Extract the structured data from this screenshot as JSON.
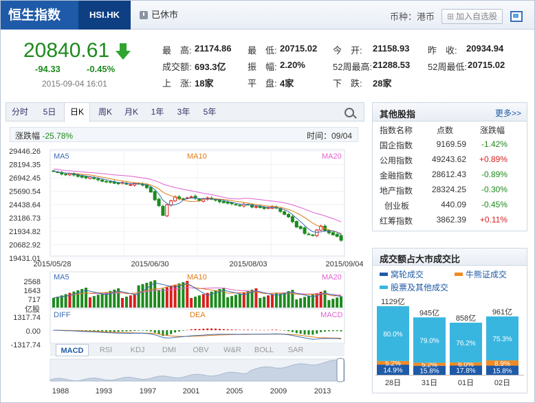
{
  "header": {
    "name": "恒生指数",
    "code": "HSI.HK",
    "status": "已休市",
    "currency": "币种：港币",
    "add_button": "加入自选股"
  },
  "quote": {
    "price": "20840.61",
    "change": "-94.33",
    "change_pct": "-0.45%",
    "time": "2015-09-04 16:01",
    "cells": [
      {
        "label": "最　高:",
        "value": "21174.86"
      },
      {
        "label": "最　低:",
        "value": "20715.02"
      },
      {
        "label": "今　开:",
        "value": "21158.93"
      },
      {
        "label": "昨　收:",
        "value": "20934.94"
      },
      {
        "label": "成交额:",
        "value": "693.3亿"
      },
      {
        "label": "振　幅:",
        "value": "2.20%"
      },
      {
        "label": "52周最高:",
        "value": "21288.53"
      },
      {
        "label": "52周最低:",
        "value": "20715.02"
      },
      {
        "label": "上　涨:",
        "value": "18家"
      },
      {
        "label": "平　盘:",
        "value": "4家"
      },
      {
        "label": "下　跌:",
        "value": "28家"
      }
    ]
  },
  "tabs": [
    "分时",
    "5日",
    "日K",
    "周K",
    "月K",
    "1年",
    "3年",
    "5年"
  ],
  "active_tab": "日K",
  "info": {
    "range_label": "涨跌幅",
    "range_value": "-25.78%",
    "time_label": "时间：",
    "time_value": "09/04"
  },
  "indicator_tabs": [
    "MACD",
    "RSI",
    "KDJ",
    "DMI",
    "OBV",
    "W&R",
    "BOLL",
    "SAR"
  ],
  "colors": {
    "up": "#d91e1e",
    "down": "#1d8a1d",
    "ma5": "#3a6db5",
    "ma10": "#e07b16",
    "ma20": "#e05fd0"
  },
  "chart_data": [
    {
      "type": "candlestick",
      "name": "kline",
      "labels": {
        "ma5": "MA5",
        "ma10": "MA10",
        "ma20": "MA20"
      },
      "y_ticks": [
        "29446.26",
        "28194.35",
        "26942.45",
        "25690.54",
        "24438.64",
        "23186.73",
        "21934.82",
        "20682.92",
        "19431.01"
      ],
      "ylim": [
        19431.01,
        29446.26
      ],
      "x_ticks": [
        "2015/05/28",
        "2015/06/30",
        "2015/08/03",
        "2015/09/04"
      ],
      "close": [
        27920,
        27850,
        27650,
        27560,
        27700,
        27550,
        27400,
        27320,
        27250,
        27350,
        27180,
        27050,
        26900,
        26850,
        26820,
        26700,
        26650,
        26780,
        26600,
        26550,
        26700,
        26650,
        26500,
        26250,
        25800,
        25000,
        24400,
        23400,
        24500,
        24900,
        25300,
        25100,
        25100,
        25200,
        25300,
        25150,
        24900,
        25100,
        25200,
        25050,
        24950,
        24800,
        24700,
        24650,
        24600,
        24500,
        24400,
        24550,
        24500,
        24250,
        24300,
        24200,
        24100,
        24200,
        24300,
        24150,
        23800,
        23500,
        23250,
        22750,
        22200,
        22050,
        21550,
        21450,
        21350,
        21900,
        22300,
        21850,
        21600,
        21400,
        21250,
        20840
      ],
      "ma5_label": "MA5",
      "ma10_label": "MA10",
      "ma20_label": "MA20"
    },
    {
      "type": "bar",
      "name": "volume",
      "labels": {
        "ma5": "MA5",
        "ma10": "MA10",
        "ma20": "MA20"
      },
      "unit": "亿股",
      "y_ticks": [
        "2568",
        "1643",
        "717"
      ],
      "ylim": [
        0,
        2700
      ]
    },
    {
      "type": "bar",
      "name": "macd",
      "labels": {
        "diff": "DIFF",
        "dea": "DEA",
        "macd": "MACD"
      },
      "y_ticks": [
        "1317.74",
        "0.00",
        "-1317.74"
      ],
      "ylim": [
        -1317.74,
        1317.74
      ]
    },
    {
      "type": "area",
      "name": "history",
      "x_ticks": [
        "1988",
        "1993",
        "1997",
        "2001",
        "2005",
        "2009",
        "2013"
      ]
    },
    {
      "type": "bar",
      "name": "turnover_share",
      "title": "成交额占大市成交比",
      "legend": [
        "窝轮成交",
        "牛熊证成交",
        "股票及其他成交"
      ],
      "categories": [
        "28日",
        "31日",
        "01日",
        "02日"
      ],
      "totals": [
        "1129亿",
        "945亿",
        "858亿",
        "961亿"
      ],
      "total_values": [
        1129,
        945,
        858,
        961
      ],
      "series": [
        {
          "name": "股票及其他成交",
          "values": [
            80.0,
            79.0,
            76.2,
            75.3
          ],
          "labels": [
            "80.0%",
            "79.0%",
            "76.2%",
            "75.3%"
          ],
          "color": "#39b6e0"
        },
        {
          "name": "牛熊证成交",
          "values": [
            5.2,
            5.2,
            6.0,
            8.9
          ],
          "labels": [
            "5.2%",
            "5.2%",
            "6.0%",
            "8.9%"
          ],
          "color": "#f08a24"
        },
        {
          "name": "窝轮成交",
          "values": [
            14.9,
            15.8,
            17.8,
            15.8
          ],
          "labels": [
            "14.9%",
            "15.8%",
            "17.8%",
            "15.8%"
          ],
          "color": "#1e5aa8"
        }
      ]
    }
  ],
  "other_indices": {
    "title": "其他股指",
    "more": "更多>>",
    "headers": [
      "指数名称",
      "点数",
      "涨跌幅"
    ],
    "rows": [
      {
        "name": "国企指数",
        "points": "9169.59",
        "change": "-1.42%",
        "dir": "dn"
      },
      {
        "name": "公用指数",
        "points": "49243.62",
        "change": "+0.89%",
        "dir": "up"
      },
      {
        "name": "金融指数",
        "points": "28612.43",
        "change": "-0.89%",
        "dir": "dn"
      },
      {
        "name": "地产指数",
        "points": "28324.25",
        "change": "-0.30%",
        "dir": "dn"
      },
      {
        "name": "创业板",
        "points": "440.09",
        "change": "-0.45%",
        "dir": "dn"
      },
      {
        "name": "红筹指数",
        "points": "3862.39",
        "change": "+0.11%",
        "dir": "up"
      }
    ]
  }
}
